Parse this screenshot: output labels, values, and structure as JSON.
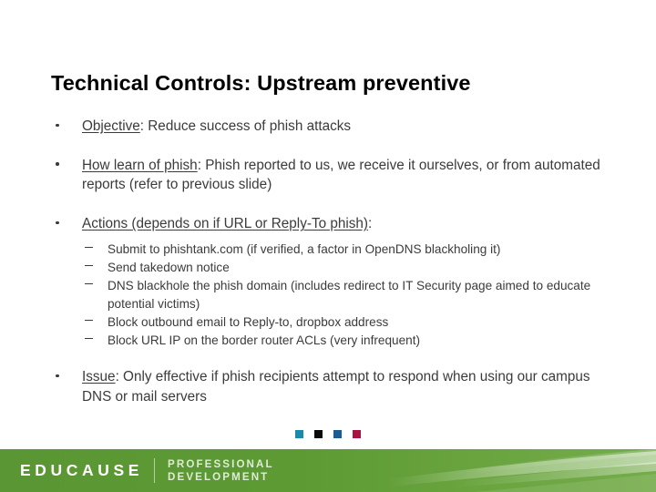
{
  "slide": {
    "title": "Technical Controls: Upstream preventive",
    "bullets": [
      {
        "lead": "Objective",
        "rest": ": Reduce success of phish attacks",
        "sub_items": []
      },
      {
        "lead": "How learn of phish",
        "rest": ": Phish reported to us, we receive it ourselves, or from automated reports (refer to previous slide)",
        "sub_items": []
      },
      {
        "lead": "Actions (depends on if URL or Reply-To phish)",
        "rest": ":",
        "sub_items": [
          "Submit to phishtank.com (if verified, a factor in OpenDNS blackholing it)",
          "Send takedown notice",
          "DNS blackhole the phish domain (includes redirect to IT Security page aimed to educate potential victims)",
          "Block outbound email to Reply-to, dropbox address",
          "Block URL IP on the border router ACLs (very infrequent)"
        ]
      },
      {
        "lead": "Issue",
        "rest": ":  Only effective if phish recipients attempt to respond when using our campus DNS or mail servers",
        "sub_items": []
      }
    ]
  },
  "decor": {
    "squares": [
      {
        "name": "square-teal",
        "color": "#1b89a8"
      },
      {
        "name": "square-black",
        "color": "#0a0a0a"
      },
      {
        "name": "square-blue",
        "color": "#1a5b92"
      },
      {
        "name": "square-crimson",
        "color": "#a8143f"
      }
    ]
  },
  "footer": {
    "brand": "EDUCAUSE",
    "sub_line1": "PROFESSIONAL",
    "sub_line2": "DEVELOPMENT",
    "band_color": "#5d9a34"
  }
}
